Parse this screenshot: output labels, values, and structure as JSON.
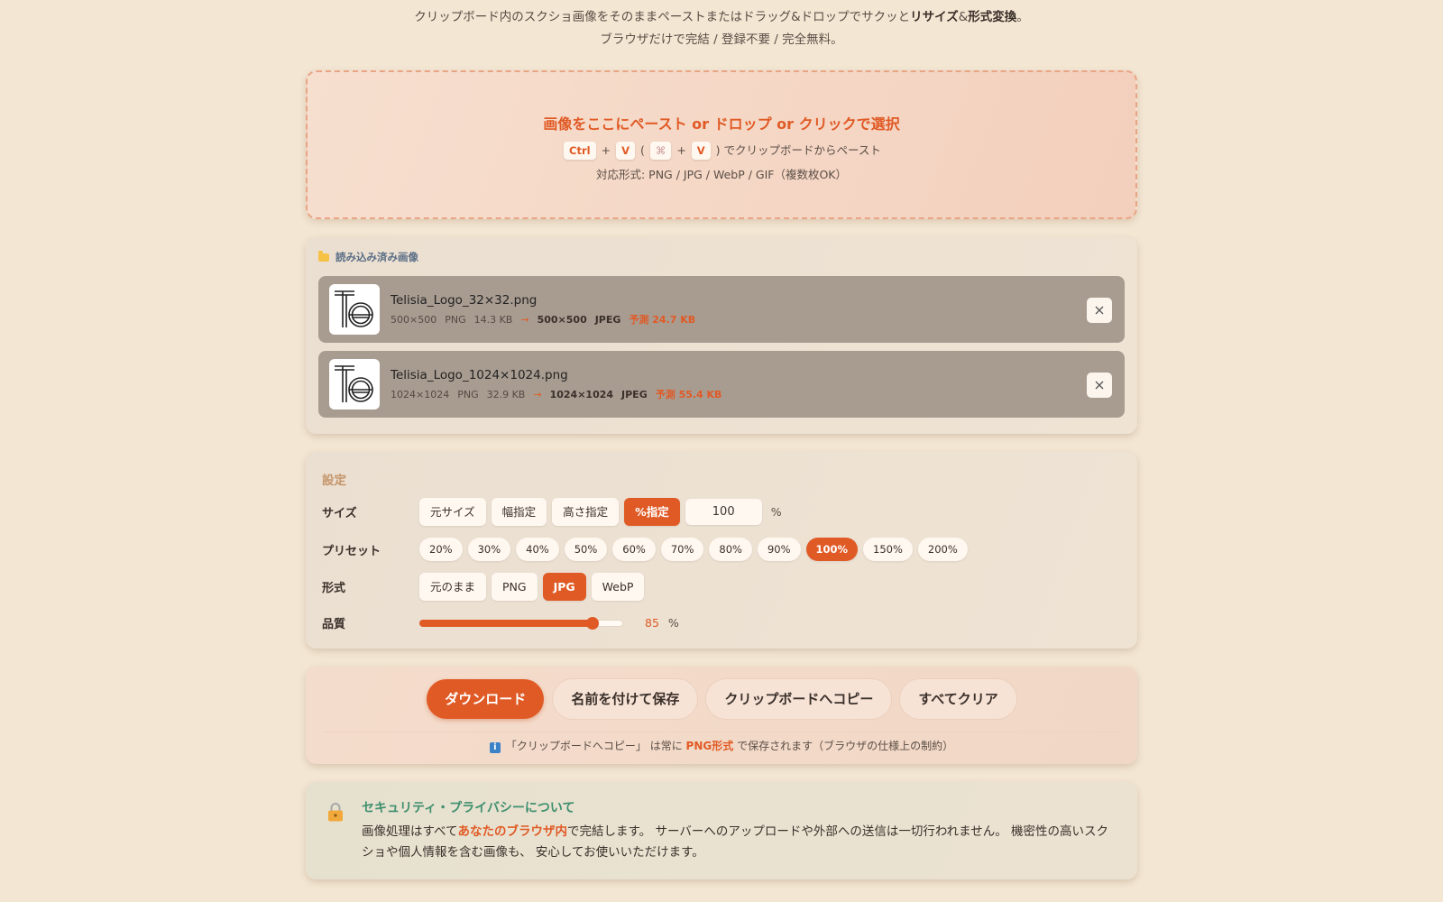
{
  "intro": {
    "line1_pre": "クリップボード内のスクショ画像をそのままペーストまたはドラッグ&ドロップでサクッと",
    "line1_b1": "リサイズ",
    "line1_amp": "&",
    "line1_b2": "形式変換",
    "line1_end": "。",
    "line2": "ブラウザだけで完結 / 登録不要 / 完全無料。"
  },
  "dropzone": {
    "title": "画像をここにペースト or ドロップ or クリックで選択",
    "key_ctrl": "Ctrl",
    "key_plus": "+",
    "key_v": "V",
    "key_cmd": "⌘",
    "paren_open": "(",
    "paren_close": ")",
    "paste_hint": "でクリップボードからペースト",
    "formats": "対応形式: PNG / JPG / WebP / GIF（複数枚OK）"
  },
  "loaded": {
    "title": "読み込み済み画像",
    "files": [
      {
        "name": "Telisia_Logo_32×32.png",
        "dims": "500×500",
        "format": "PNG",
        "size": "14.3 KB",
        "arrow": "→",
        "out_dims": "500×500",
        "out_format": "JPEG",
        "estimate": "予測 24.7 KB"
      },
      {
        "name": "Telisia_Logo_1024×1024.png",
        "dims": "1024×1024",
        "format": "PNG",
        "size": "32.9 KB",
        "arrow": "→",
        "out_dims": "1024×1024",
        "out_format": "JPEG",
        "estimate": "予測 55.4 KB"
      }
    ]
  },
  "settings": {
    "title": "設定",
    "size_label": "サイズ",
    "size_modes": [
      "元サイズ",
      "幅指定",
      "高さ指定",
      "%指定"
    ],
    "size_active": "%指定",
    "size_value": "100",
    "size_unit": "%",
    "preset_label": "プリセット",
    "presets": [
      "20%",
      "30%",
      "40%",
      "50%",
      "60%",
      "70%",
      "80%",
      "90%",
      "100%",
      "150%",
      "200%"
    ],
    "preset_active": "100%",
    "format_label": "形式",
    "formats": [
      "元のまま",
      "PNG",
      "JPG",
      "WebP"
    ],
    "format_active": "JPG",
    "quality_label": "品質",
    "quality_value": "85",
    "quality_unit": "%",
    "quality_level": 85
  },
  "actions": {
    "download": "ダウンロード",
    "save_as": "名前を付けて保存",
    "copy": "クリップボードへコピー",
    "clear": "すべてクリア",
    "note_pre": "「クリップボードへコピー」 は常に",
    "note_bold": "PNG形式",
    "note_post": "で保存されます（ブラウザの仕様上の制約）"
  },
  "security": {
    "title": "セキュリティ・プライバシーについて",
    "body_pre": "画像処理はすべて",
    "body_bold": "あなたのブラウザ内",
    "body_post": "で完結します。 サーバーへのアップロードや外部への送信は一切行われません。 機密性の高いスクショや個人情報を含む画像も、 安心してお使いいただけます。"
  },
  "colors": {
    "accent": "#e05a25",
    "background": "#f3e6d3",
    "security_title": "#3f8f6e"
  }
}
